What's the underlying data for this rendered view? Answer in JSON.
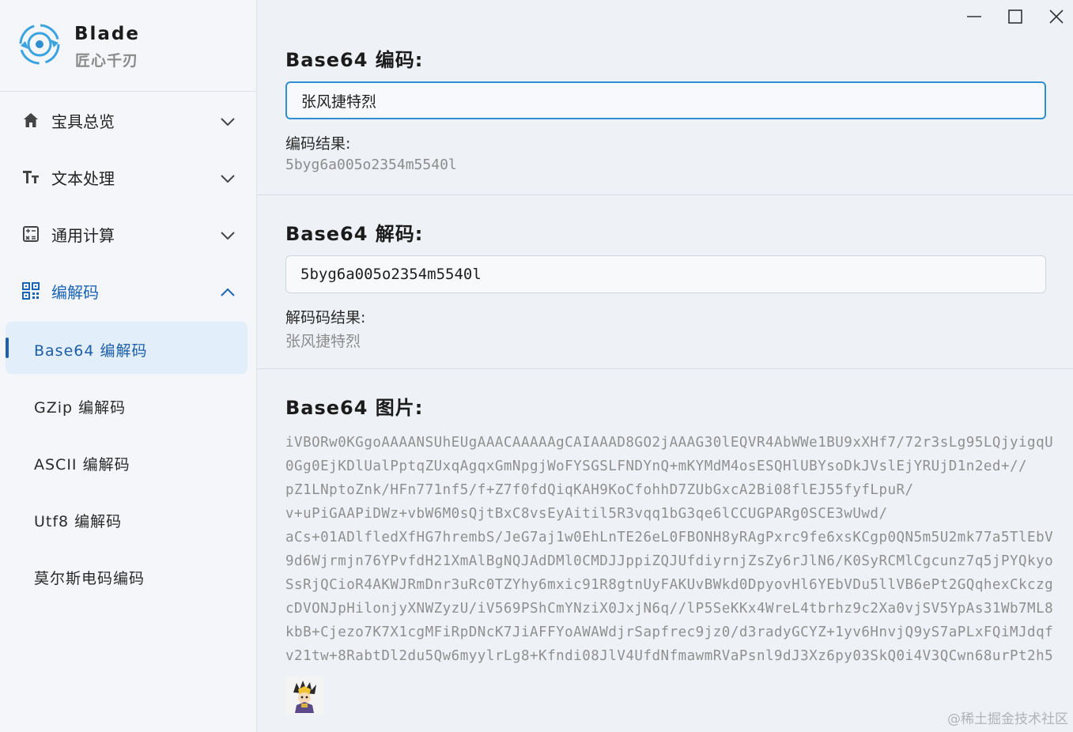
{
  "brand": {
    "name": "Blade",
    "subtitle": "匠心千刃",
    "logo_icon": "blade-logo-icon"
  },
  "sidebar": {
    "groups": [
      {
        "label": "宝具总览",
        "icon": "home-icon",
        "expanded": false
      },
      {
        "label": "文本处理",
        "icon": "text-size-icon",
        "expanded": false
      },
      {
        "label": "通用计算",
        "icon": "calculator-icon",
        "expanded": false
      },
      {
        "label": "编解码",
        "icon": "qr-code-icon",
        "expanded": true
      }
    ],
    "sub_items": [
      {
        "label": "Base64 编解码",
        "selected": true
      },
      {
        "label": "GZip 编解码",
        "selected": false
      },
      {
        "label": "ASCII 编解码",
        "selected": false
      },
      {
        "label": "Utf8 编解码",
        "selected": false
      },
      {
        "label": "莫尔斯电码编码",
        "selected": false
      }
    ]
  },
  "window_controls": [
    "minimize-icon",
    "maximize-icon",
    "close-icon"
  ],
  "encode": {
    "title": "Base64 编码:",
    "input_value": "张风捷特烈",
    "result_label": "编码结果:",
    "result_value": "5byg6a005o2354m5540l"
  },
  "decode": {
    "title": "Base64 解码:",
    "input_value": "5byg6a005o2354m5540l",
    "result_label": "解码码结果:",
    "result_value": "张风捷特烈"
  },
  "image": {
    "title": "Base64 图片:",
    "lines": [
      "iVBORw0KGgoAAAANSUhEUgAAACAAAAAgCAIAAAD8GO2jAAAG30lEQVR4AbWWe1BU9xXHf7/72r3sLg95LQjyigqU",
      "0Gg0EjKDlUalPptqZUxqAgqxGmNpgjWoFYSGSLFNDYnQ+mKYMdM4osESQHlUBYsoDkJVslEjYRUjD1n2ed+//",
      "pZ1LNptoZnk/HFn771nf5/f+Z7f0fdQiqKAH9KoCfohhD7ZUbGxcA2Bi08flEJ55fyfLpuR/",
      "v+uPiGAAPiDWz+vbW6M0sQjtBxC8vsEyAitil5R3vqq1bG3qe6lCCUGPARg0SCE3wUwd/",
      "aCs+01ADlfledXfHG7hrembS/JeG7aj1w0EhLnTE26eL0FBONH8yRAgPxrc9fe6xsKCgp0QN5m5U2mk77a5TlEbV",
      "9d6Wjrmjn76YPvfdH21XmAlBgNQJAdDMl0CMDJJppiZQJUfdiyrnjZsZy6rJlN6/K0SyRCMlCgcunz7q5jPYQkyo",
      "SsRjQCioR4AKWJRmDnr3uRc0TZYhy6mxic91R8gtnUyFAKUvBWkd0DpyovHl6YEbVDu5llVB6ePt2GQqhexCkczg",
      "cDVONJpHilonjyXNWZyzU/iV569PShCmYNziX0JxjN6q//lP5SeKKx4WreL4tbrhz9c2Xa0vjSV5YpAs31Wb7ML8",
      "kbB+Cjezo7K7X1cgMFiRpDNcK7JiAFFYoAWAWdjrSapfrec9jz0/d3radyGCYZ+1yv6HnvjQ9yS7aPLxFQiMJdqf",
      "v21tw+8RabtDl2du5Qw6myylrLg8+Kfndi08JlV4UfdNfmawmRVaPsnl9dJ3Xz6py03SkQ0i4V3QCwn68urPt2h5"
    ],
    "thumbnail_icon": "avatar-thumbnail-icon"
  },
  "watermark": "@稀土掘金技术社区",
  "colors": {
    "accent": "#1a64b8",
    "selected_bg": "#e2eef9",
    "focus_border": "#2f8fd0"
  }
}
